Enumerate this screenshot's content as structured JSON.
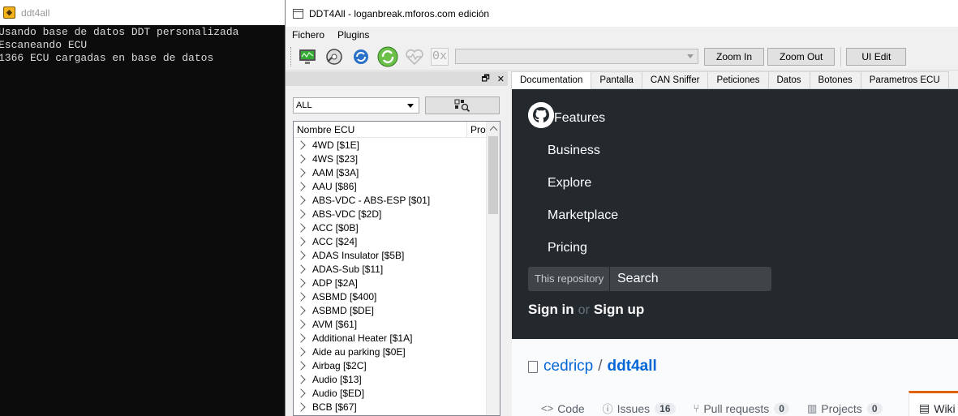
{
  "console": {
    "title": "ddt4all",
    "lines": [
      "Usando base de datos DDT personalizada",
      "Escaneando ECU",
      "1366 ECU cargadas en base de datos"
    ]
  },
  "app": {
    "title": "DDT4All - loganbreak.mforos.com edición",
    "menu": [
      "Fichero",
      "Plugins"
    ],
    "toolbar": {
      "zoom_in": "Zoom In",
      "zoom_out": "Zoom Out",
      "ui_edit": "UI Edit",
      "hex_label": "0x"
    },
    "dock": {
      "float_glyph": "🗗",
      "close_glyph": "✕",
      "filter_value": "ALL",
      "columns": [
        "Nombre ECU",
        "Pro"
      ],
      "ecus": [
        "4WD [$1E]",
        "4WS [$23]",
        "AAM [$3A]",
        "AAU [$86]",
        "ABS-VDC - ABS-ESP [$01]",
        "ABS-VDC [$2D]",
        "ACC [$0B]",
        "ACC [$24]",
        "ADAS Insulator [$5B]",
        "ADAS-Sub [$11]",
        "ADP [$2A]",
        "ASBMD [$400]",
        "ASBMD [$DE]",
        "AVM [$61]",
        "Additional Heater [$1A]",
        "Aide au parking [$0E]",
        "Airbag [$2C]",
        "Audio [$13]",
        "Audio [$ED]",
        "BCB [$67]"
      ]
    },
    "tabs": [
      "Documentation",
      "Pantalla",
      "CAN Sniffer",
      "Peticiones",
      "Datos",
      "Botones",
      "Parametros ECU"
    ],
    "active_tab": "Documentation",
    "web": {
      "nav": [
        "Features",
        "Business",
        "Explore",
        "Marketplace",
        "Pricing"
      ],
      "search_scope": "This repository",
      "search_placeholder": "Search",
      "sign_in": "Sign in",
      "or": "or",
      "sign_up": "Sign up",
      "repo_owner": "cedricp",
      "repo_sep": "/",
      "repo_name": "ddt4all",
      "repo_nav": [
        {
          "label": "Code",
          "count": ""
        },
        {
          "label": "Issues",
          "count": "16"
        },
        {
          "label": "Pull requests",
          "count": "0"
        },
        {
          "label": "Projects",
          "count": "0"
        }
      ],
      "wiki_label": "Wiki",
      "colors": {
        "header_bg": "#24292e",
        "link": "#0366d6",
        "active_tab": "#e36209"
      }
    }
  }
}
